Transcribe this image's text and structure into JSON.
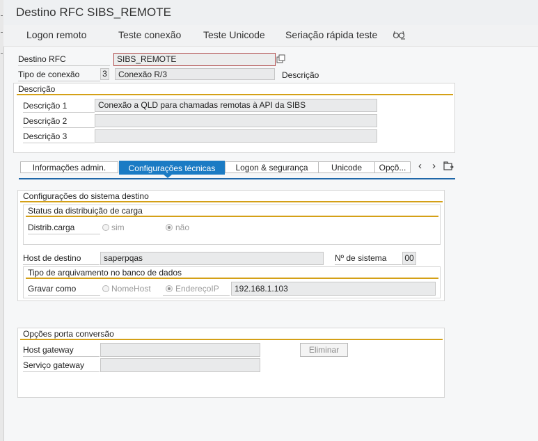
{
  "window": {
    "title": "Destino RFC SIBS_REMOTE"
  },
  "toolbar": {
    "logon_remoto": "Logon remoto",
    "teste_conexao": "Teste conexão",
    "teste_unicode": "Teste Unicode",
    "seriacao": "Seriação rápida teste",
    "extra_icon": "glasses-icon"
  },
  "header": {
    "destino_label": "Destino RFC",
    "destino_value": "SIBS_REMOTE",
    "tipo_label": "Tipo de conexão",
    "tipo_code": "3",
    "tipo_desc": "Conexão R/3",
    "descricao_label": "Descrição"
  },
  "descricao_group": {
    "title": "Descrição",
    "rows": [
      {
        "label": "Descrição 1",
        "value": "Conexão a QLD para chamadas remotas à API da SIBS"
      },
      {
        "label": "Descrição 2",
        "value": ""
      },
      {
        "label": "Descrição 3",
        "value": ""
      }
    ]
  },
  "tabs": [
    {
      "label": "Informações admin.",
      "active": false
    },
    {
      "label": "Configurações técnicas",
      "active": true
    },
    {
      "label": "Logon & segurança",
      "active": false
    },
    {
      "label": "Unicode",
      "active": false
    },
    {
      "label": "Opçõ...",
      "active": false
    }
  ],
  "tab_nav": {
    "prev": "‹",
    "next": "›"
  },
  "config_sistema": {
    "title": "Configurações do sistema destino",
    "carga_group": {
      "title": "Status da distribuição de carga",
      "label": "Distrib.carga",
      "opt_sim": "sim",
      "opt_nao": "não",
      "selected": "não"
    },
    "host_label": "Host de destino",
    "host_value": "saperpqas",
    "sistema_label": "Nº de sistema",
    "sistema_value": "00",
    "arquivamento_group": {
      "title": "Tipo de arquivamento no banco de dados",
      "label": "Gravar como",
      "opt_nomehost": "NomeHost",
      "opt_enderecoip": "EndereçoIP",
      "selected": "EndereçoIP",
      "ip_value": "192.168.1.103"
    }
  },
  "opcoes_porta": {
    "title": "Opções porta conversão",
    "host_gateway_label": "Host gateway",
    "host_gateway_value": "",
    "servico_gateway_label": "Serviço gateway",
    "servico_gateway_value": "",
    "eliminar": "Eliminar"
  },
  "colors": {
    "tab_active": "#1b7bc4",
    "gold_underline": "#d4a017",
    "tab_line": "#1f67a8"
  }
}
